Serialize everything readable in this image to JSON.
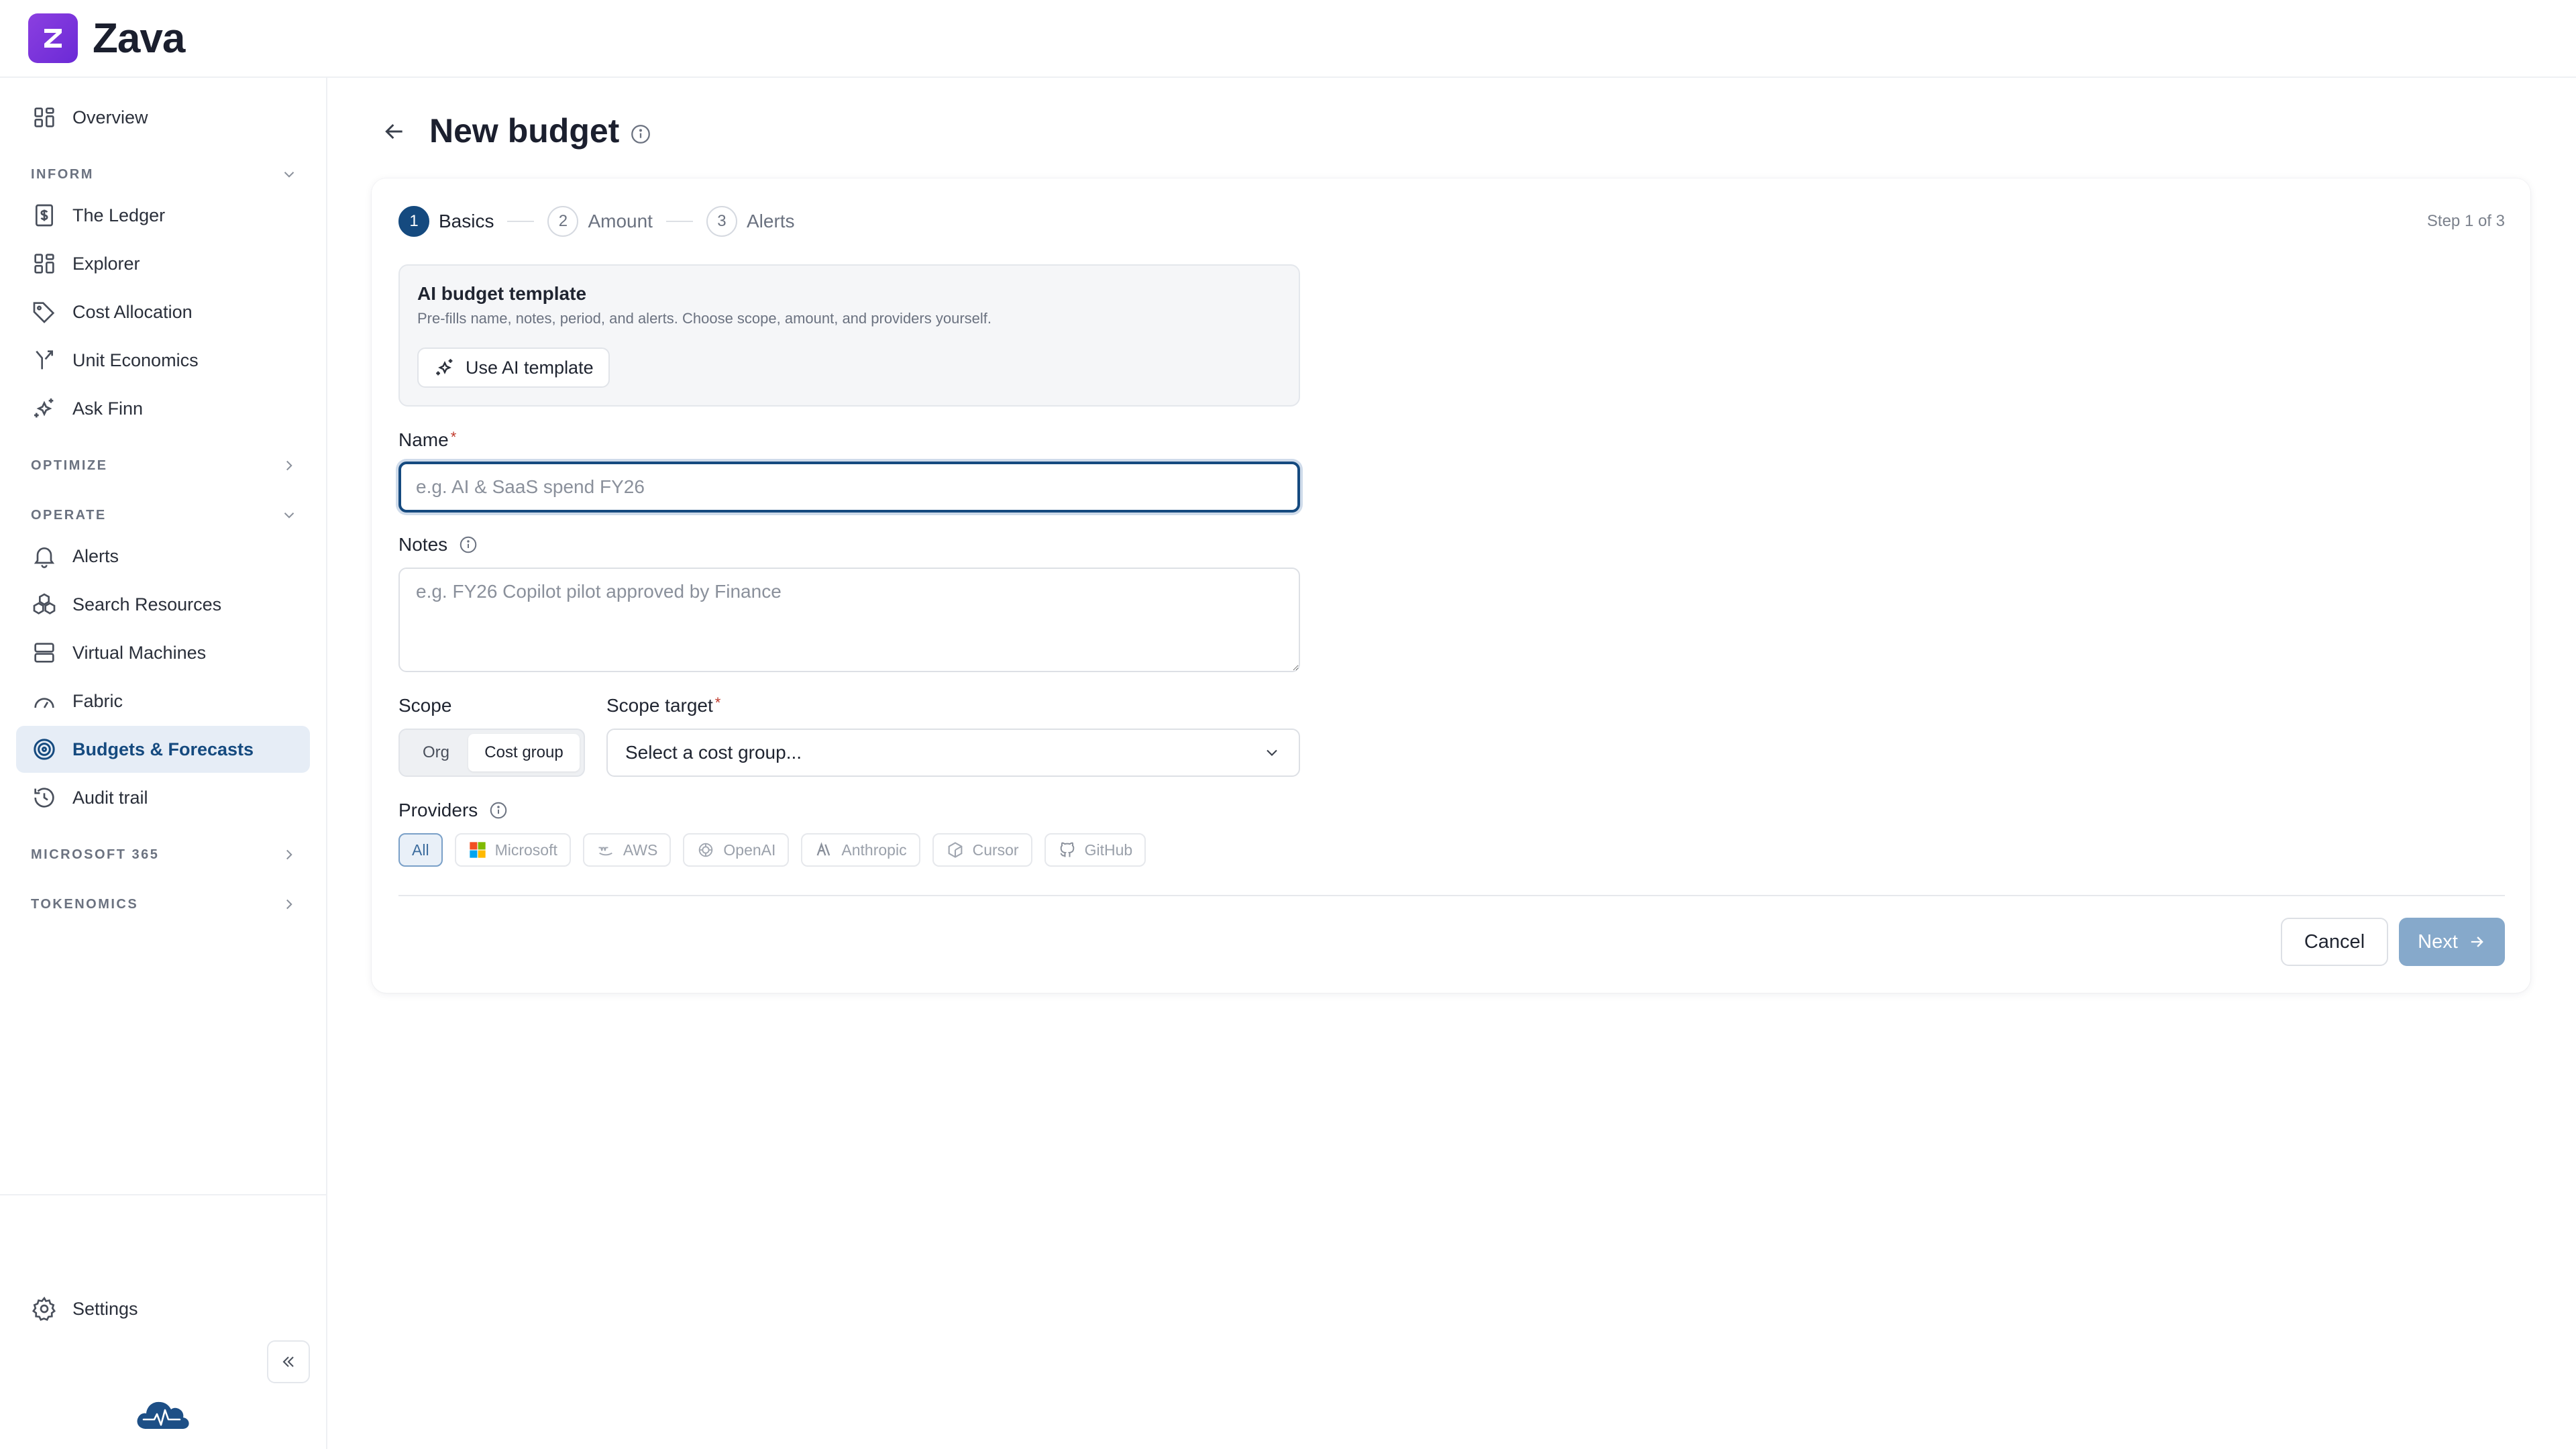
{
  "app": {
    "name": "Zava",
    "logo_letter": "Z",
    "brand_color": "#7a35dc",
    "accent_color": "#154a7f"
  },
  "sidebar": {
    "overview": {
      "label": "Overview",
      "icon": "grid-icon"
    },
    "sections": {
      "inform": "INFORM",
      "optimize": "OPTIMIZE",
      "operate": "OPERATE",
      "microsoft365": "MICROSOFT 365",
      "tokenomics": "TOKENOMICS"
    },
    "inform_items": [
      {
        "label": "The Ledger",
        "icon": "ledger-icon"
      },
      {
        "label": "Explorer",
        "icon": "grid-icon"
      },
      {
        "label": "Cost Allocation",
        "icon": "tag-icon"
      },
      {
        "label": "Unit Economics",
        "icon": "fork-icon"
      },
      {
        "label": "Ask Finn",
        "icon": "sparkle-icon"
      }
    ],
    "operate_items": [
      {
        "label": "Alerts",
        "icon": "bell-icon"
      },
      {
        "label": "Search Resources",
        "icon": "cubes-icon"
      },
      {
        "label": "Virtual Machines",
        "icon": "server-icon"
      },
      {
        "label": "Fabric",
        "icon": "gauge-icon"
      },
      {
        "label": "Budgets & Forecasts",
        "icon": "target-icon",
        "active": true
      },
      {
        "label": "Audit trail",
        "icon": "history-icon"
      }
    ],
    "settings": {
      "label": "Settings",
      "icon": "gear-icon"
    }
  },
  "page": {
    "title": "New budget"
  },
  "stepper": {
    "steps": [
      {
        "num": "1",
        "label": "Basics",
        "active": true
      },
      {
        "num": "2",
        "label": "Amount",
        "active": false
      },
      {
        "num": "3",
        "label": "Alerts",
        "active": false
      }
    ],
    "count": "Step 1 of 3"
  },
  "ai_template": {
    "title": "AI budget template",
    "description": "Pre-fills name, notes, period, and alerts. Choose scope, amount, and providers yourself.",
    "button": "Use AI template"
  },
  "form": {
    "name": {
      "label": "Name",
      "required": "*",
      "value": "",
      "placeholder": "e.g. AI & SaaS spend FY26"
    },
    "notes": {
      "label": "Notes",
      "value": "",
      "placeholder": "e.g. FY26 Copilot pilot approved by Finance"
    },
    "scope": {
      "label": "Scope",
      "options": [
        "Org",
        "Cost group"
      ],
      "selected": "Cost group"
    },
    "scope_target": {
      "label": "Scope target",
      "required": "*",
      "value": "Select a cost group..."
    },
    "providers": {
      "label": "Providers",
      "items": [
        {
          "label": "All",
          "active": true
        },
        {
          "label": "Microsoft",
          "icon": "microsoft-icon"
        },
        {
          "label": "AWS",
          "icon": "aws-icon"
        },
        {
          "label": "OpenAI",
          "icon": "openai-icon"
        },
        {
          "label": "Anthropic",
          "icon": "anthropic-icon"
        },
        {
          "label": "Cursor",
          "icon": "cursor-icon"
        },
        {
          "label": "GitHub",
          "icon": "github-icon"
        }
      ]
    }
  },
  "actions": {
    "cancel": "Cancel",
    "next": "Next"
  }
}
